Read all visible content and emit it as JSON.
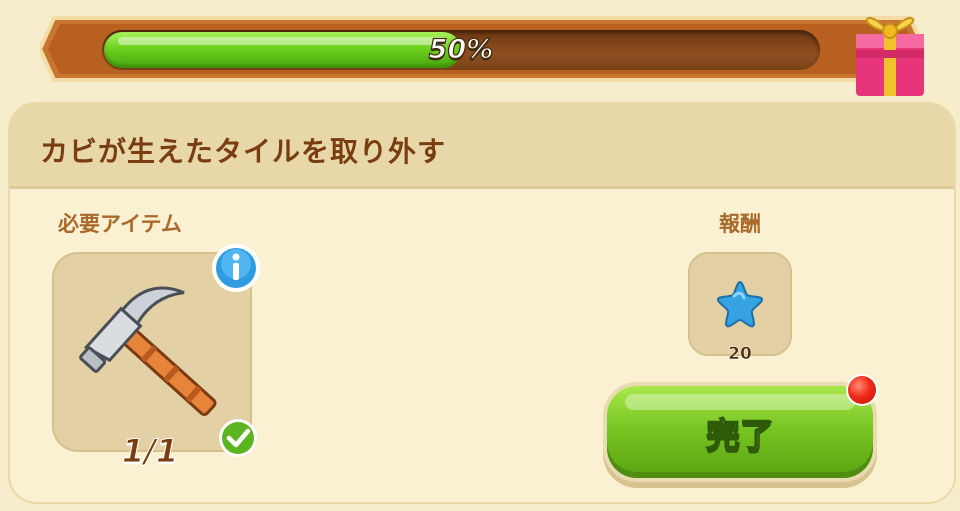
{
  "progress": {
    "fraction": 0.5,
    "label": "50%"
  },
  "task": {
    "title": "カビが生えたタイルを取り外す"
  },
  "required_items": {
    "label": "必要アイテム",
    "item_icon": "hammer-icon",
    "count": "1/1",
    "info_icon": "info-icon",
    "status_icon": "check-icon"
  },
  "reward": {
    "label": "報酬",
    "icon": "blue-star-icon",
    "amount": "20"
  },
  "complete_button": {
    "label": "完了",
    "has_notification": true
  },
  "colors": {
    "progress_fill": "#6ed11f",
    "title_text": "#7a3d10",
    "button_green": "#78c623",
    "notification": "#f02b18",
    "star": "#3aa7e6"
  }
}
